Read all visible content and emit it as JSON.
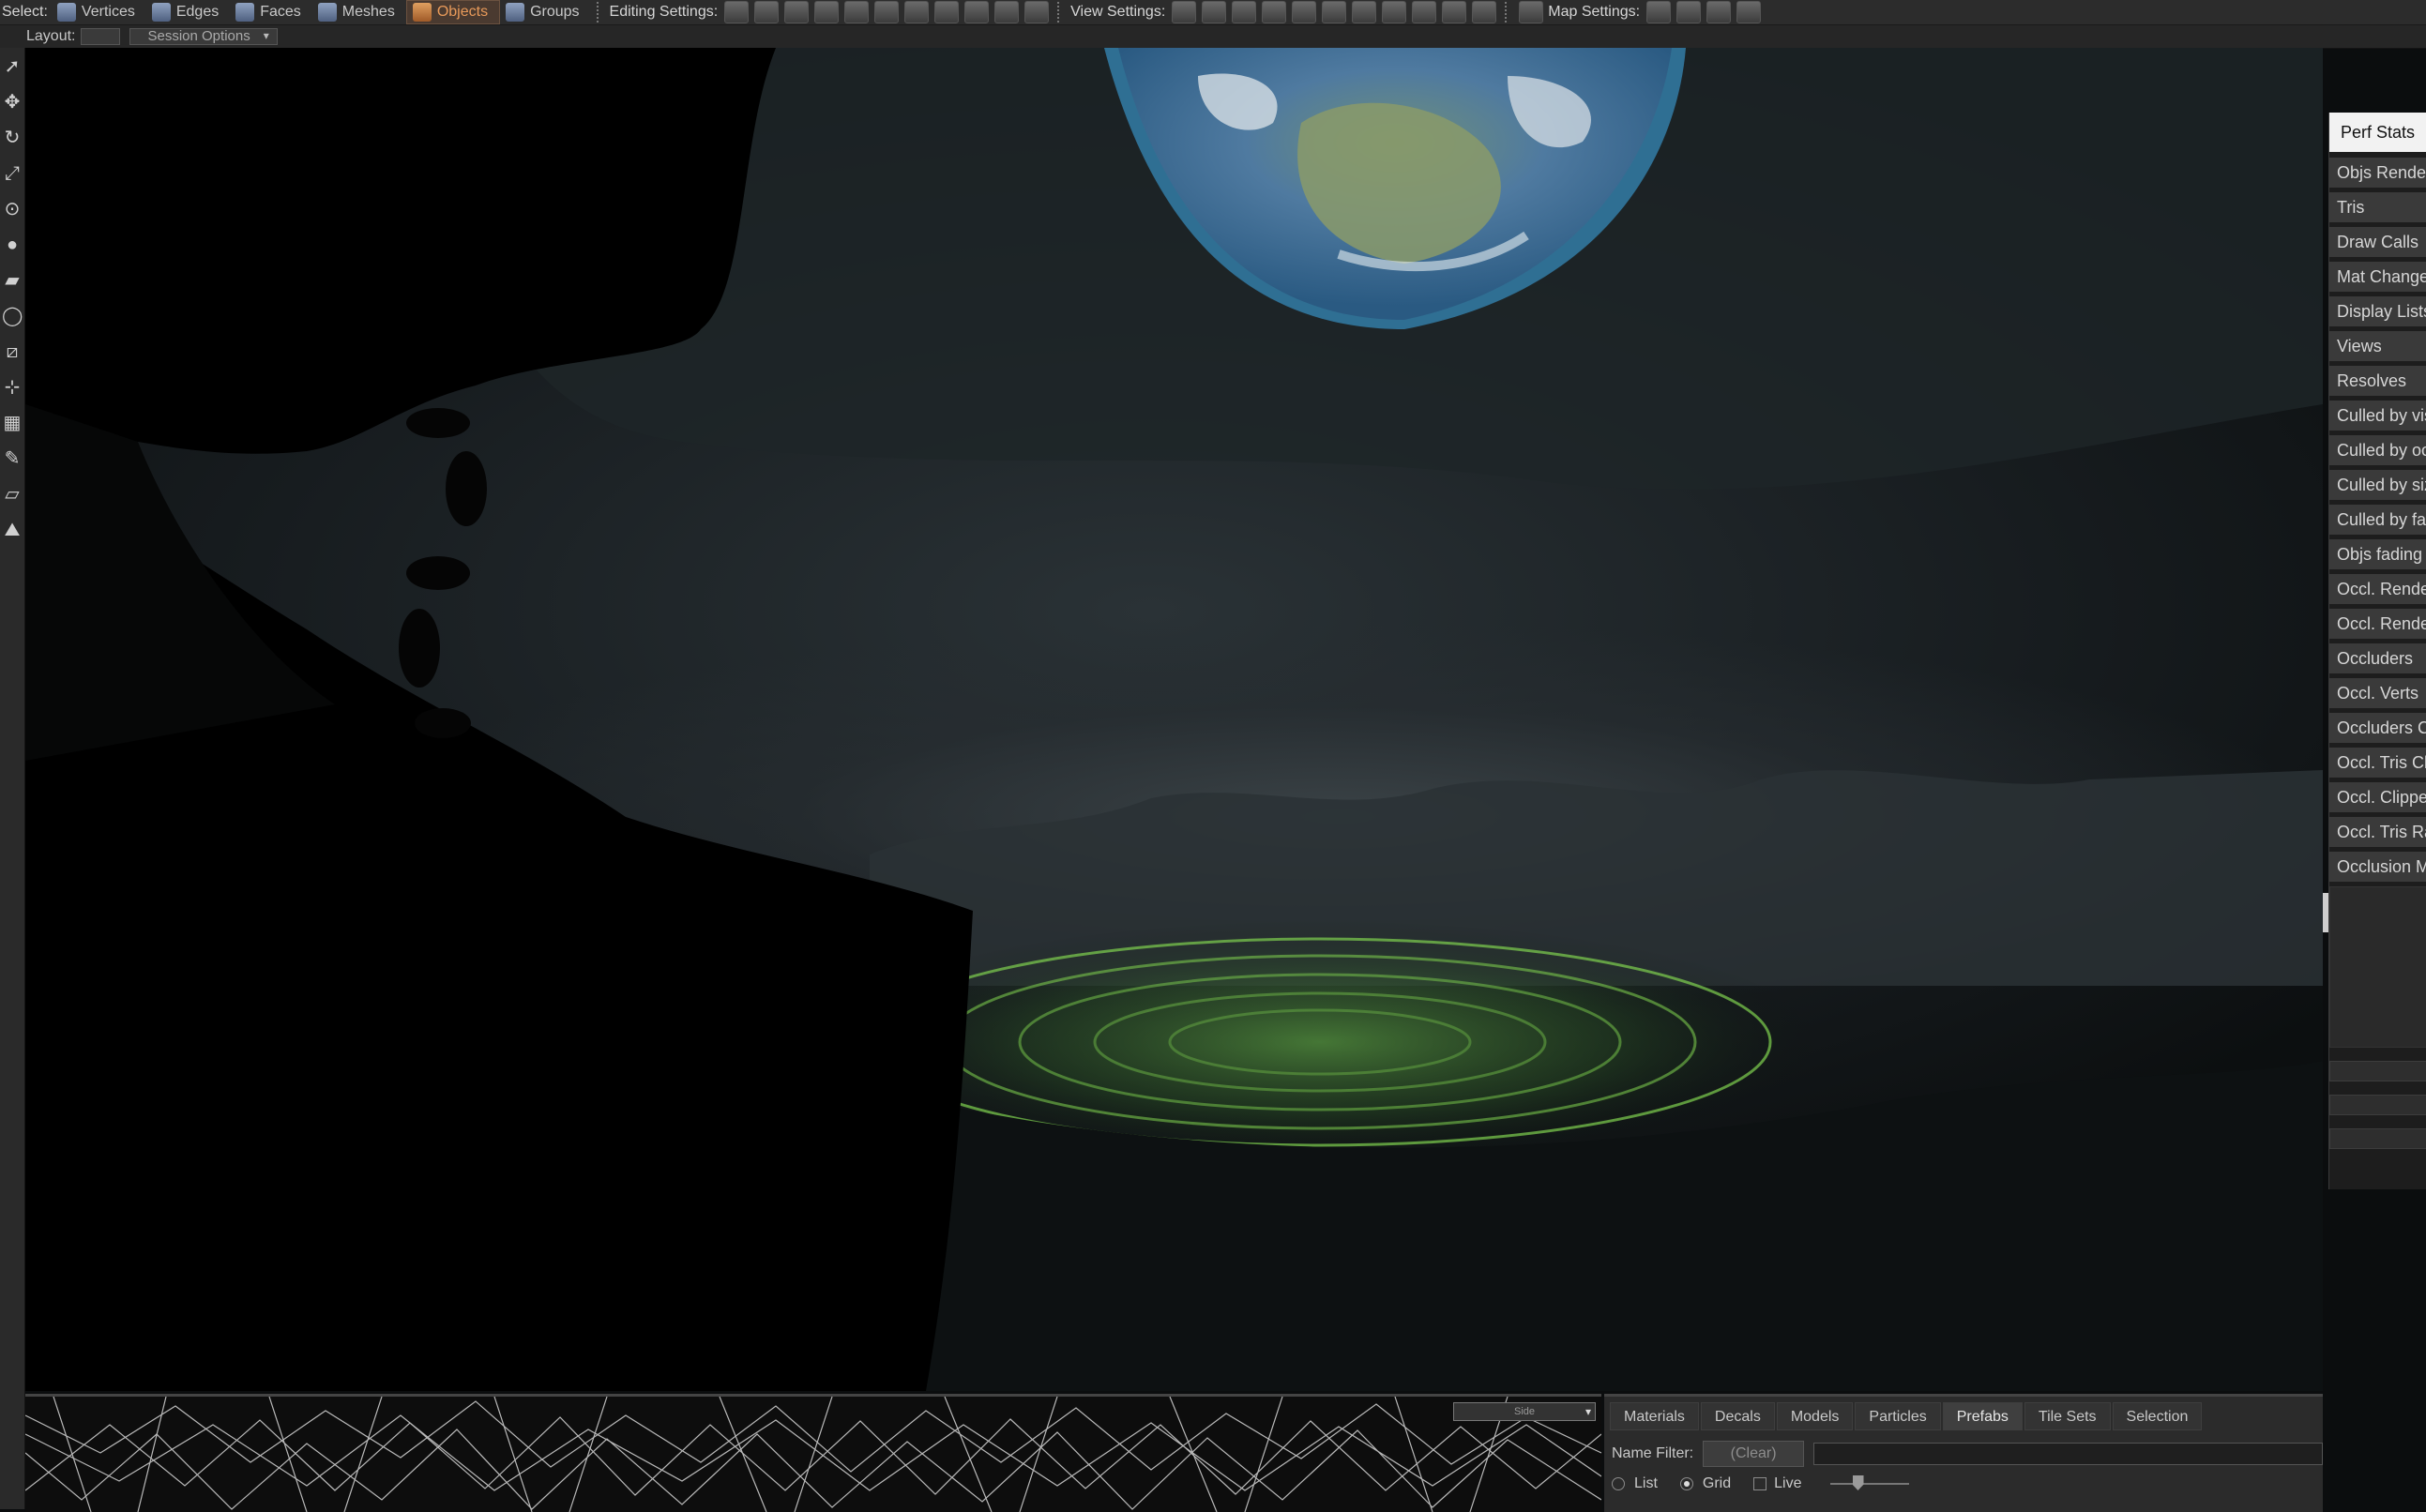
{
  "toolbar": {
    "select_label": "Select:",
    "select_modes": [
      "Vertices",
      "Edges",
      "Faces",
      "Meshes",
      "Objects",
      "Groups"
    ],
    "active_mode": "Objects",
    "editing_settings_label": "Editing Settings:",
    "view_settings_label": "View Settings:",
    "map_settings_label": "Map Settings:"
  },
  "layout": {
    "label": "Layout:",
    "session_options": "Session Options"
  },
  "tools": [
    "select-arrow-icon",
    "move-icon",
    "rotate-icon",
    "scale-icon",
    "pivot-icon",
    "light-bulb-icon",
    "brush-icon",
    "lasso-icon",
    "cut-icon",
    "align-icon",
    "checker-icon",
    "eyedropper-icon",
    "eraser-icon",
    "terrain-icon"
  ],
  "perf_stats": {
    "title": "Perf Stats",
    "rows": [
      "Objs Rendered",
      "Tris",
      "Draw Calls",
      "Mat Changes",
      "Display Lists",
      "Views",
      "Resolves",
      "Culled by vis",
      "Culled by occ",
      "Culled by size",
      "Culled by fade",
      "Objs fading",
      "Occl. Rendered",
      "Occl. Rendered",
      "Occluders",
      "Occl. Verts",
      "Occluders Clipped",
      "Occl. Tris Clipped",
      "Occl. Clipped",
      "Occl. Tris Rasterized",
      "Occlusion Misc"
    ]
  },
  "wireframe": {
    "view_select": "Side"
  },
  "asset_browser": {
    "tabs": [
      "Materials",
      "Decals",
      "Models",
      "Particles",
      "Prefabs",
      "Tile Sets",
      "Selection"
    ],
    "active_tab": "Prefabs",
    "name_filter_label": "Name Filter:",
    "clear_label": "(Clear)",
    "view_options": [
      "List",
      "Grid"
    ],
    "selected_view": "Grid",
    "live_label": "Live"
  }
}
